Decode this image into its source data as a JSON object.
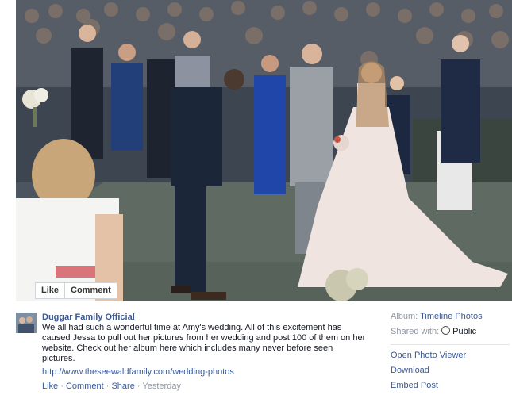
{
  "photo": {
    "like_label": "Like",
    "comment_label": "Comment"
  },
  "post": {
    "author": "Duggar Family Official",
    "text": "We all had such a wonderful time at Amy's wedding. All of this excitement has caused Jessa to pull out her pictures from her wedding and post 100 of them on her website. Check out her album here which includes many never before seen pictures.",
    "link": "http://www.theseewaldfamily.com/wedding-photos",
    "actions": {
      "like": "Like",
      "comment": "Comment",
      "share": "Share",
      "time": "Yesterday",
      "dot": "·"
    }
  },
  "sidebar": {
    "album_label": "Album:",
    "album_value": "Timeline Photos",
    "shared_label": "Shared with:",
    "shared_value": "Public",
    "links": [
      "Open Photo Viewer",
      "Download",
      "Embed Post"
    ]
  },
  "colors": {
    "link_blue": "#3b5998",
    "meta_gray": "#9197a3"
  }
}
